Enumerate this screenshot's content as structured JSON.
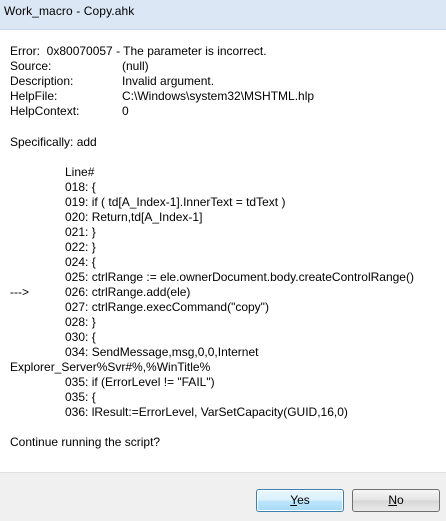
{
  "window": {
    "title": "Work_macro - Copy.ahk"
  },
  "message": {
    "error": "Error:  0x80070057 - The parameter is incorrect.",
    "fields": [
      {
        "key": "Source:",
        "value": "(null)"
      },
      {
        "key": "Description:",
        "value": "Invalid argument."
      },
      {
        "key": "HelpFile:",
        "value": "C:\\Windows\\system32\\MSHTML.hlp"
      },
      {
        "key": "HelpContext:",
        "value": "0"
      }
    ],
    "specifically": "Specifically: add",
    "line_header": "Line#",
    "code": [
      "018: {",
      "019: if ( td[A_Index-1].InnerText = tdText )",
      "020: Return,td[A_Index-1]",
      "021: }",
      "022: }",
      "024: {",
      "025: ctrlRange := ele.ownerDocument.body.createControlRange()",
      "026: ctrlRange.add(ele)",
      "027: ctrlRange.execCommand(\"copy\")",
      "028: }",
      "030: {",
      "034: SendMessage,msg,0,0,Internet",
      "Explorer_Server%Svr#%,%WinTitle%",
      "035: if (ErrorLevel != \"FAIL\")",
      "035: {",
      "036: lResult:=ErrorLevel, VarSetCapacity(GUID,16,0)"
    ],
    "arrow": "--->",
    "prompt": "Continue running the script?"
  },
  "buttons": {
    "yes_u": "Y",
    "yes_rest": "es",
    "no_u": "N",
    "no_rest": "o"
  }
}
